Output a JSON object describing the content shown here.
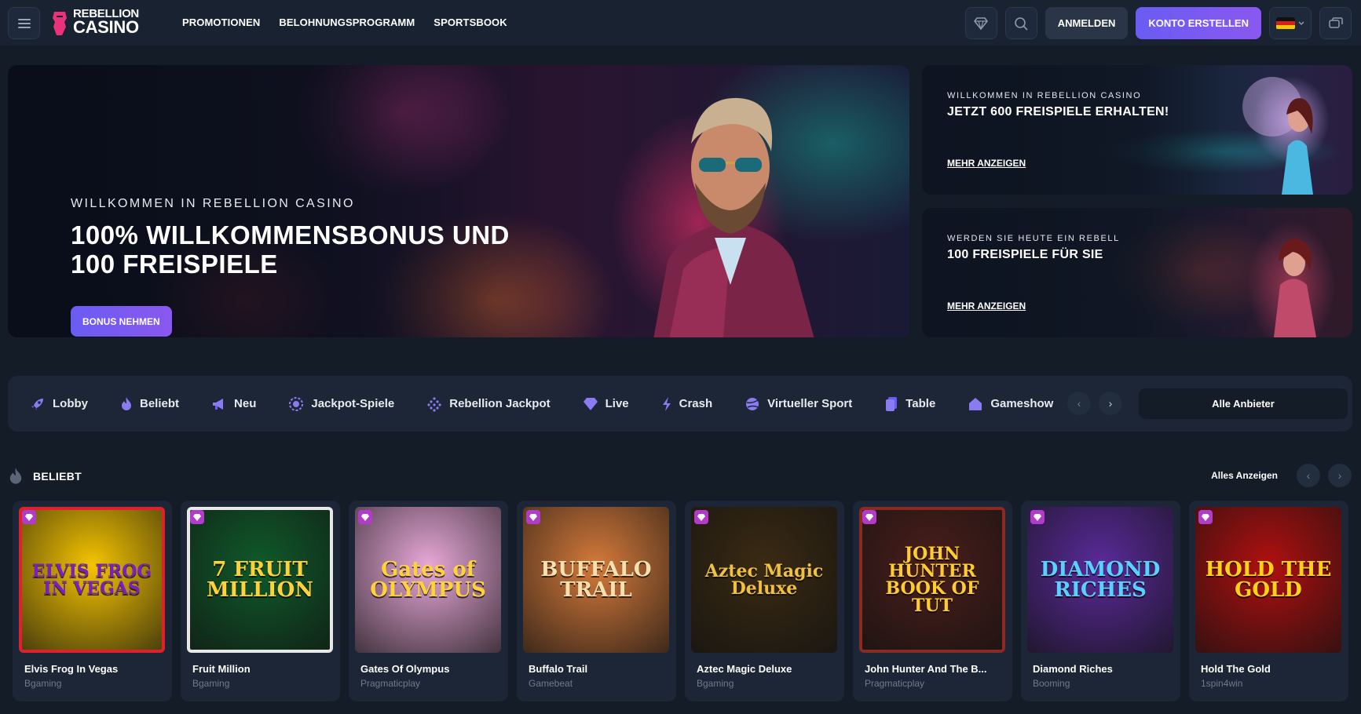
{
  "header": {
    "logo_line1": "REBELLION",
    "logo_line2": "CASINO",
    "nav": [
      "PROMOTIONEN",
      "BELOHNUNGSPROGRAMM",
      "SPORTSBOOK"
    ],
    "login_label": "ANMELDEN",
    "register_label": "KONTO ERSTELLEN",
    "language": "DE"
  },
  "hero": {
    "subtitle": "WILLKOMMEN IN REBELLION CASINO",
    "title": "100% WILLKOMMENSBONUS UND 100 FREISPIELE",
    "button": "BONUS NEHMEN"
  },
  "promos": [
    {
      "subtitle": "WILLKOMMEN IN REBELLION CASINO",
      "title": "JETZT 600 FREISPIELE ERHALTEN!",
      "link": "MEHR ANZEIGEN"
    },
    {
      "subtitle": "WERDEN SIE HEUTE EIN REBELL",
      "title": "100 FREISPIELE FÜR SIE",
      "link": "MEHR ANZEIGEN"
    }
  ],
  "categories": [
    {
      "label": "Lobby",
      "icon": "rocket-icon"
    },
    {
      "label": "Beliebt",
      "icon": "flame-icon"
    },
    {
      "label": "Neu",
      "icon": "megaphone-icon"
    },
    {
      "label": "Jackpot-Spiele",
      "icon": "jackpot-icon"
    },
    {
      "label": "Rebellion Jackpot",
      "icon": "diamond-dots-icon"
    },
    {
      "label": "Live",
      "icon": "gem-icon"
    },
    {
      "label": "Crash",
      "icon": "lightning-icon"
    },
    {
      "label": "Virtueller Sport",
      "icon": "ball-icon"
    },
    {
      "label": "Table",
      "icon": "cards-icon"
    },
    {
      "label": "Gameshow",
      "icon": "home-icon"
    }
  ],
  "providers_label": "Alle Anbieter",
  "section": {
    "title": "BELIEBT",
    "view_all": "Alles Anzeigen"
  },
  "games": [
    {
      "name": "Elvis Frog In Vegas",
      "provider": "Bgaming",
      "art": "ELVIS FROG IN VEGAS",
      "bg": "#f5c400",
      "fg": "#7a1fc4",
      "border": "#e0202a"
    },
    {
      "name": "Fruit Million",
      "provider": "Bgaming",
      "art": "7 FRUIT MILLION",
      "bg": "#0f5a2a",
      "fg": "#ffd23a",
      "border": "#e8e8e8"
    },
    {
      "name": "Gates Of Olympus",
      "provider": "Pragmaticplay",
      "art": "Gates of OLYMPUS",
      "bg": "#e8a8d8",
      "fg": "#ffd23a",
      "border": "none"
    },
    {
      "name": "Buffalo Trail",
      "provider": "Gamebeat",
      "art": "BUFFALO TRAIL",
      "bg": "#d57a3a",
      "fg": "#f5e0b0",
      "border": "none"
    },
    {
      "name": "Aztec Magic Deluxe",
      "provider": "Bgaming",
      "art": "Aztec Magic Deluxe",
      "bg": "#3a2a12",
      "fg": "#f0c040",
      "border": "none"
    },
    {
      "name": "John Hunter And The B...",
      "provider": "Pragmaticplay",
      "art": "JOHN HUNTER BOOK OF TUT",
      "bg": "#4a1e1a",
      "fg": "#ffcc30",
      "border": "#8a2a20"
    },
    {
      "name": "Diamond Riches",
      "provider": "Booming",
      "art": "DIAMOND RICHES",
      "bg": "#5a2a9a",
      "fg": "#5ad0ff",
      "border": "none"
    },
    {
      "name": "Hold The Gold",
      "provider": "1spin4win",
      "art": "HOLD THE GOLD",
      "bg": "#b01010",
      "fg": "#ffd21a",
      "border": "none"
    }
  ],
  "colors": {
    "accent": "#7a5af5",
    "background": "#141c28",
    "panel": "#1c2636"
  }
}
